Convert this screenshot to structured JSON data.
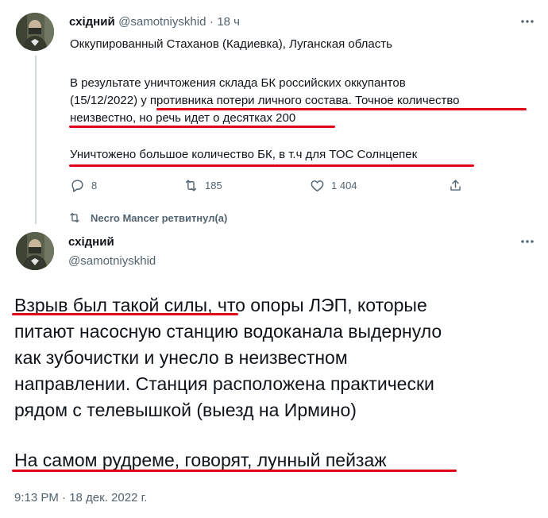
{
  "tweet1": {
    "name": "східний",
    "handle": "@samotniyskhid",
    "separator": "·",
    "time": "18 ч",
    "line1": "Оккупированный Стаханов (Кадиевка), Луганская область",
    "para2_line1": "В результате уничтожения склада БК российских оккупантов",
    "para2_line2a": "(15/12/2022) ",
    "para2_line2b": "у противника потери личного состава. Точное количество",
    "para2_line3": "неизвестно, но речь идет о десятках 200",
    "para3": "Уничтожено большое количество БК, в т.ч для ТОС Солнцепек",
    "actions": {
      "replies": "8",
      "retweets": "185",
      "likes": "1 404"
    },
    "icons": [
      "reply-icon",
      "retweet-icon",
      "like-icon",
      "share-icon",
      "more-icon"
    ]
  },
  "retweet_banner": {
    "text": "Necro Mancer ретвитнул(а)"
  },
  "tweet2": {
    "name": "східний",
    "handle": "@samotniyskhid",
    "body_line1a": "Взрыв был такой силы",
    "body_line1b": ", что опоры ЛЭП, которые",
    "body_line2": "питают насосную станцию водоканала выдернуло",
    "body_line3": "как зубочистки и унесло в неизвестном",
    "body_line4": "направлении. Станция расположена практически",
    "body_line5": "рядом с телевышкой (выезд на Ирмино)",
    "body_line6": "На самом рудреме, говорят, лунный пейзаж",
    "timestamp": "9:13 PM · 18 дек. 2022 г."
  },
  "colors": {
    "text": "#0f1419",
    "muted": "#536471",
    "annotation_red": "#e0061a"
  }
}
